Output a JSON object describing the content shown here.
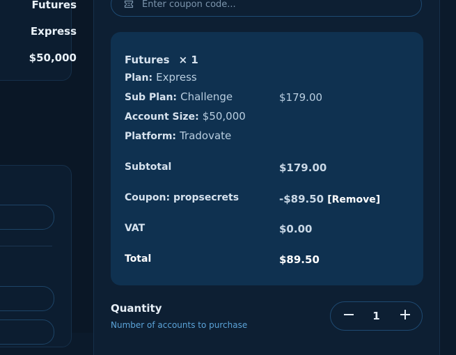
{
  "left_panel": {
    "values": [
      "Futures",
      "Express",
      "$50,000"
    ]
  },
  "coupon": {
    "placeholder": "Enter coupon code..."
  },
  "summary": {
    "product": "Futures",
    "quantity_marker": "× 1",
    "plan_label": "Plan:",
    "plan_value": "Express",
    "subplan_label": "Sub Plan:",
    "subplan_value": "Challenge",
    "size_label": "Account Size:",
    "size_value": "$50,000",
    "platform_label": "Platform:",
    "platform_value": "Tradovate",
    "item_price": "$179.00",
    "subtotal_label": "Subtotal",
    "subtotal_value": "$179.00",
    "coupon_label": "Coupon: propsecrets",
    "coupon_value": "-$89.50",
    "remove_label": "[Remove]",
    "vat_label": "VAT",
    "vat_value": "$0.00",
    "total_label": "Total",
    "total_value": "$89.50"
  },
  "quantity": {
    "title": "Quantity",
    "subtitle": "Number of accounts to purchase",
    "value": "1",
    "decrement_icon": "minus-icon",
    "increment_icon": "plus-icon"
  },
  "colors": {
    "background": "#0b1a2b",
    "card": "#0f3150",
    "accent": "#5ba3d8"
  }
}
